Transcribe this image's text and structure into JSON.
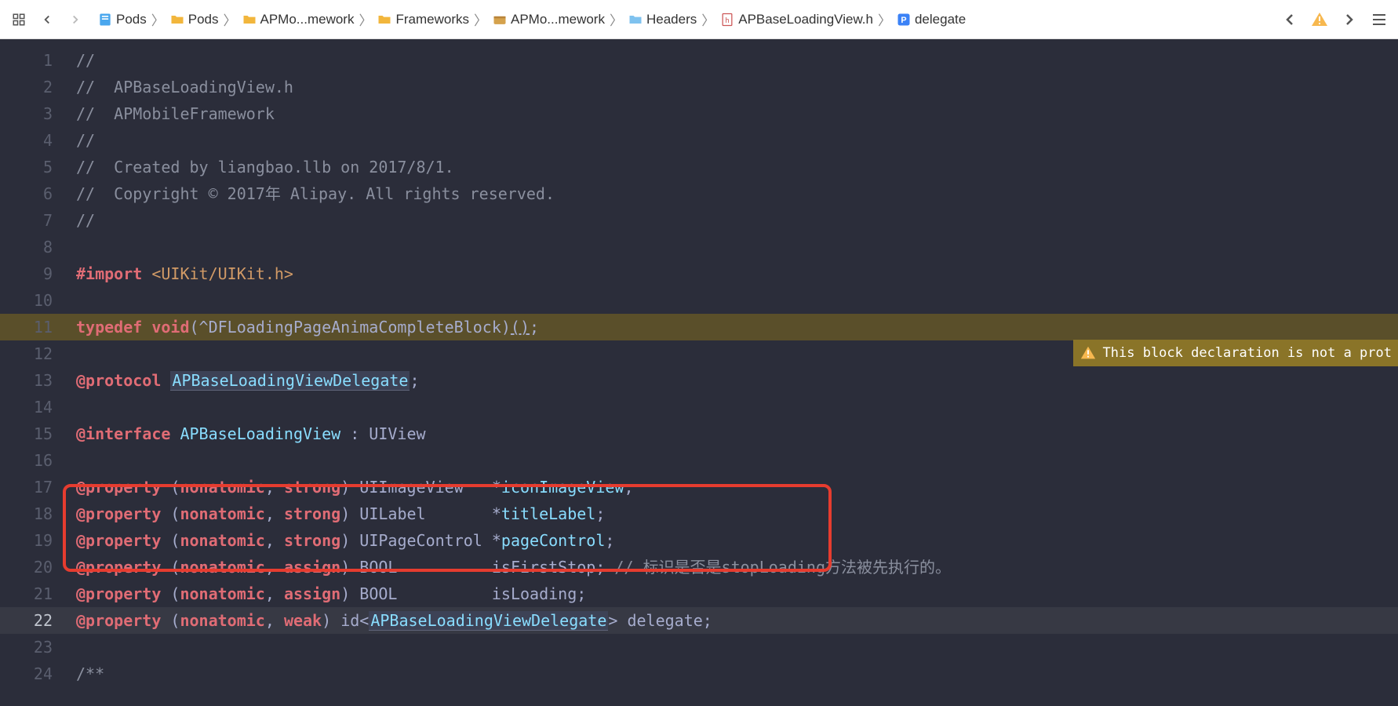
{
  "breadcrumbs": [
    {
      "label": "Pods",
      "icon": "project"
    },
    {
      "label": "Pods",
      "icon": "folder-yellow"
    },
    {
      "label": "APMo...mework",
      "icon": "folder-yellow"
    },
    {
      "label": "Frameworks",
      "icon": "folder-yellow"
    },
    {
      "label": "APMo...mework",
      "icon": "framework"
    },
    {
      "label": "Headers",
      "icon": "folder-blue"
    },
    {
      "label": "APBaseLoadingView.h",
      "icon": "header"
    },
    {
      "label": "delegate",
      "icon": "property"
    }
  ],
  "warning": {
    "text": "This block declaration is not a prot"
  },
  "code": {
    "lines": [
      {
        "n": 1,
        "segments": [
          {
            "t": "//",
            "c": "c-comment"
          }
        ]
      },
      {
        "n": 2,
        "segments": [
          {
            "t": "//  APBaseLoadingView.h",
            "c": "c-comment"
          }
        ]
      },
      {
        "n": 3,
        "segments": [
          {
            "t": "//  APMobileFramework",
            "c": "c-comment"
          }
        ]
      },
      {
        "n": 4,
        "segments": [
          {
            "t": "//",
            "c": "c-comment"
          }
        ]
      },
      {
        "n": 5,
        "segments": [
          {
            "t": "//  Created by liangbao.llb on 2017/8/1.",
            "c": "c-comment"
          }
        ]
      },
      {
        "n": 6,
        "segments": [
          {
            "t": "//  Copyright © 2017年 Alipay. All rights reserved.",
            "c": "c-comment"
          }
        ]
      },
      {
        "n": 7,
        "segments": [
          {
            "t": "//",
            "c": "c-comment"
          }
        ]
      },
      {
        "n": 8,
        "segments": []
      },
      {
        "n": 9,
        "segments": [
          {
            "t": "#import ",
            "c": "c-keyword"
          },
          {
            "t": "<UIKit/UIKit.h>",
            "c": "c-string"
          }
        ]
      },
      {
        "n": 10,
        "segments": []
      },
      {
        "n": 11,
        "warn": true,
        "segments": [
          {
            "t": "typedef ",
            "c": "c-keyword"
          },
          {
            "t": "void",
            "c": "c-storage"
          },
          {
            "t": "(^DFLoadingPageAnimaCompleteBlock)",
            "c": "c-type"
          },
          {
            "t": "()",
            "c": "c-type",
            "u": true
          },
          {
            "t": ";",
            "c": "c-punc"
          }
        ]
      },
      {
        "n": 12,
        "segments": []
      },
      {
        "n": 13,
        "segments": [
          {
            "t": "@protocol ",
            "c": "c-keyword"
          },
          {
            "t": "APBaseLoadingViewDelegate",
            "c": "c-class",
            "hl": true
          },
          {
            "t": ";",
            "c": "c-punc"
          }
        ]
      },
      {
        "n": 14,
        "segments": []
      },
      {
        "n": 15,
        "segments": [
          {
            "t": "@interface ",
            "c": "c-keyword"
          },
          {
            "t": "APBaseLoadingView",
            "c": "c-class"
          },
          {
            "t": " : ",
            "c": "c-punc"
          },
          {
            "t": "UIView",
            "c": "c-type"
          }
        ]
      },
      {
        "n": 16,
        "segments": []
      },
      {
        "n": 17,
        "segments": [
          {
            "t": "@property ",
            "c": "c-keyword"
          },
          {
            "t": "(",
            "c": "c-punc"
          },
          {
            "t": "nonatomic",
            "c": "c-keyword"
          },
          {
            "t": ", ",
            "c": "c-punc"
          },
          {
            "t": "strong",
            "c": "c-keyword"
          },
          {
            "t": ") ",
            "c": "c-punc"
          },
          {
            "t": "UIImageView   *",
            "c": "c-type"
          },
          {
            "t": "iconImageView",
            "c": "c-prop"
          },
          {
            "t": ";",
            "c": "c-punc"
          }
        ]
      },
      {
        "n": 18,
        "segments": [
          {
            "t": "@property ",
            "c": "c-keyword"
          },
          {
            "t": "(",
            "c": "c-punc"
          },
          {
            "t": "nonatomic",
            "c": "c-keyword"
          },
          {
            "t": ", ",
            "c": "c-punc"
          },
          {
            "t": "strong",
            "c": "c-keyword"
          },
          {
            "t": ") ",
            "c": "c-punc"
          },
          {
            "t": "UILabel       *",
            "c": "c-type"
          },
          {
            "t": "titleLabel",
            "c": "c-prop"
          },
          {
            "t": ";",
            "c": "c-punc"
          }
        ]
      },
      {
        "n": 19,
        "segments": [
          {
            "t": "@property ",
            "c": "c-keyword"
          },
          {
            "t": "(",
            "c": "c-punc"
          },
          {
            "t": "nonatomic",
            "c": "c-keyword"
          },
          {
            "t": ", ",
            "c": "c-punc"
          },
          {
            "t": "strong",
            "c": "c-keyword"
          },
          {
            "t": ") ",
            "c": "c-punc"
          },
          {
            "t": "UIPageControl *",
            "c": "c-type"
          },
          {
            "t": "pageControl",
            "c": "c-prop"
          },
          {
            "t": ";",
            "c": "c-punc"
          }
        ]
      },
      {
        "n": 20,
        "segments": [
          {
            "t": "@property ",
            "c": "c-keyword"
          },
          {
            "t": "(",
            "c": "c-punc"
          },
          {
            "t": "nonatomic",
            "c": "c-keyword"
          },
          {
            "t": ", ",
            "c": "c-punc"
          },
          {
            "t": "assign",
            "c": "c-keyword"
          },
          {
            "t": ") ",
            "c": "c-punc"
          },
          {
            "t": "BOOL          ",
            "c": "c-type"
          },
          {
            "t": "isFirstStop",
            "c": "c-type"
          },
          {
            "t": "; ",
            "c": "c-punc"
          },
          {
            "t": "// 标识是否是stopLoading方法被先执行的。",
            "c": "c-comment"
          }
        ]
      },
      {
        "n": 21,
        "segments": [
          {
            "t": "@property ",
            "c": "c-keyword"
          },
          {
            "t": "(",
            "c": "c-punc"
          },
          {
            "t": "nonatomic",
            "c": "c-keyword"
          },
          {
            "t": ", ",
            "c": "c-punc"
          },
          {
            "t": "assign",
            "c": "c-keyword"
          },
          {
            "t": ") ",
            "c": "c-punc"
          },
          {
            "t": "BOOL          ",
            "c": "c-type"
          },
          {
            "t": "isLoading",
            "c": "c-type"
          },
          {
            "t": ";",
            "c": "c-punc"
          }
        ]
      },
      {
        "n": 22,
        "hl": true,
        "segments": [
          {
            "t": "@property ",
            "c": "c-keyword"
          },
          {
            "t": "(",
            "c": "c-punc"
          },
          {
            "t": "nonatomic",
            "c": "c-keyword"
          },
          {
            "t": ", ",
            "c": "c-punc"
          },
          {
            "t": "weak",
            "c": "c-keyword"
          },
          {
            "t": ") ",
            "c": "c-punc"
          },
          {
            "t": "id",
            "c": "c-type"
          },
          {
            "t": "<",
            "c": "c-punc"
          },
          {
            "t": "APBaseLoadingViewDelegate",
            "c": "c-class",
            "hl": true
          },
          {
            "t": "> ",
            "c": "c-punc"
          },
          {
            "t": "delegate",
            "c": "c-type"
          },
          {
            "t": ";",
            "c": "c-punc"
          }
        ]
      },
      {
        "n": 23,
        "segments": []
      },
      {
        "n": 24,
        "segments": [
          {
            "t": "/**",
            "c": "c-comment"
          }
        ]
      }
    ]
  }
}
